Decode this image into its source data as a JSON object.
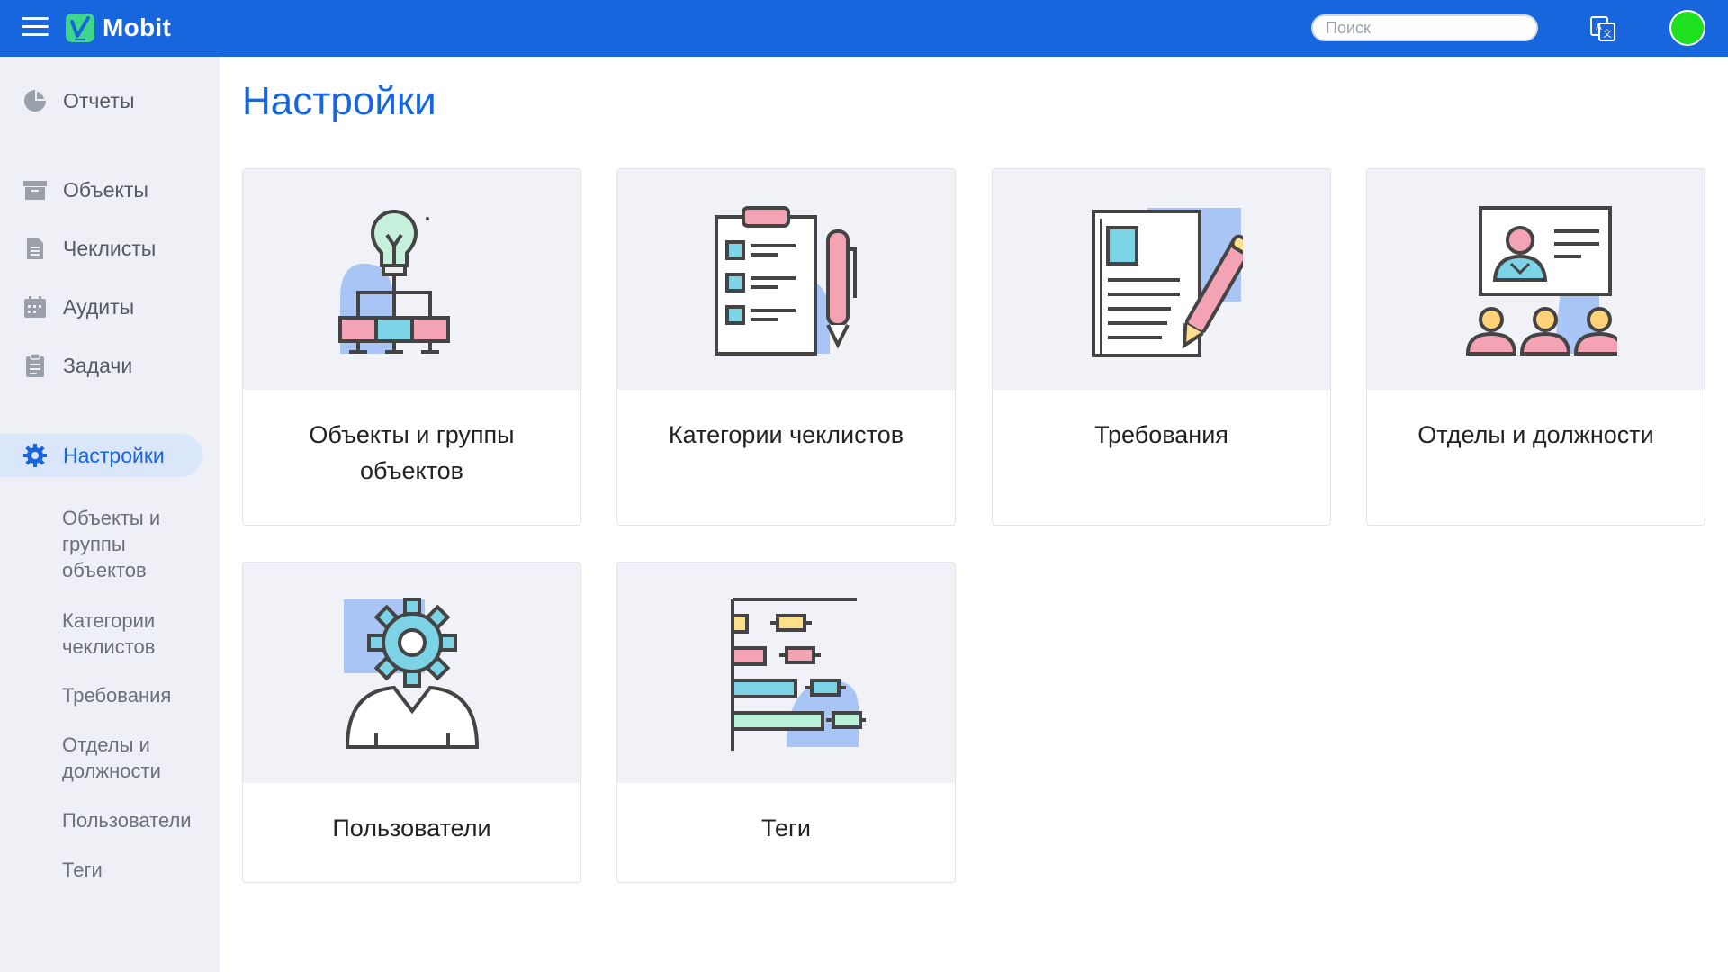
{
  "app": {
    "name": "Mobit",
    "brand_color": "#1766dd",
    "status_color": "#1ee01e"
  },
  "header": {
    "search_placeholder": "Поиск",
    "icons": [
      "menu-icon",
      "translate-icon"
    ]
  },
  "sidebar": {
    "items": [
      {
        "label": "Отчеты",
        "icon": "pie-chart-icon"
      },
      {
        "label": "Объекты",
        "icon": "archive-icon"
      },
      {
        "label": "Чеклисты",
        "icon": "document-icon"
      },
      {
        "label": "Аудиты",
        "icon": "calendar-icon"
      },
      {
        "label": "Задачи",
        "icon": "clipboard-icon"
      },
      {
        "label": "Настройки",
        "icon": "gear-icon",
        "active": true
      }
    ],
    "subitems": [
      {
        "label": "Объекты и группы объектов"
      },
      {
        "label": "Категории чеклистов"
      },
      {
        "label": "Требования"
      },
      {
        "label": "Отделы и должности"
      },
      {
        "label": "Пользователи"
      },
      {
        "label": "Теги"
      }
    ]
  },
  "main": {
    "title": "Настройки",
    "cards": [
      {
        "title": "Объекты и группы объектов",
        "icon": "object-hierarchy-icon"
      },
      {
        "title": "Категории чеклистов",
        "icon": "checklist-clipboard-icon"
      },
      {
        "title": "Требования",
        "icon": "document-pencil-icon"
      },
      {
        "title": "Отделы и должности",
        "icon": "presentation-people-icon"
      },
      {
        "title": "Пользователи",
        "icon": "user-gear-icon"
      },
      {
        "title": "Теги",
        "icon": "tags-chart-icon"
      }
    ]
  }
}
